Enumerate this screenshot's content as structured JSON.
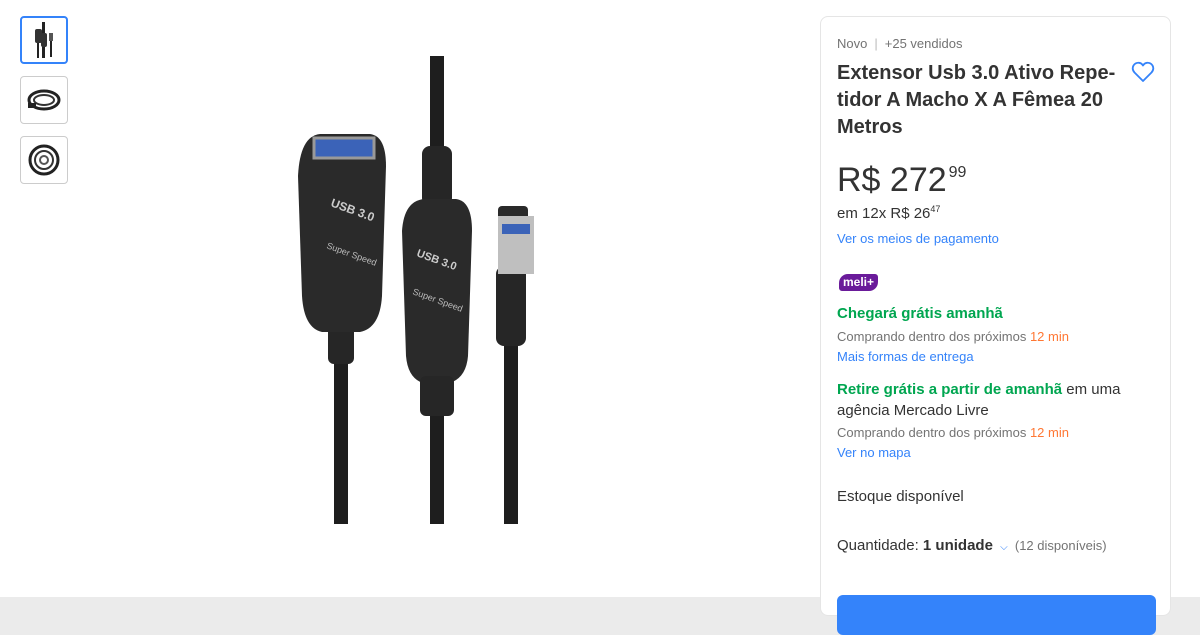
{
  "product": {
    "condition": "Novo",
    "sold": "+25 vendidos",
    "title": "Extensor Usb 3.0 Ativo Repe-tidor A Macho X A Fêmea 20 Metros",
    "price_currency": "R$",
    "price_whole": "272",
    "price_cents": "99",
    "installments_prefix": "em 12x R$",
    "installments_whole": "26",
    "installments_cents": "47",
    "payment_link": "Ver os meios de pagamento"
  },
  "shipping": {
    "badge": "meli+",
    "arrival": "Chegará grátis amanhã",
    "buy_within_prefix": "Comprando dentro dos próximos",
    "buy_within_time": "12 min",
    "more_options": "Mais formas de entrega",
    "pickup_highlight": "Retire grátis a partir de amanhã",
    "pickup_rest": " em uma agência Mercado Livre",
    "buy_within_prefix_2": "Comprando dentro dos próximos",
    "buy_within_time_2": "12 min",
    "map_link": "Ver no mapa"
  },
  "stock": {
    "label": "Estoque disponível",
    "quantity_label": "Quantidade:",
    "quantity_value": "1 unidade",
    "available": "(12 disponíveis)"
  },
  "colors": {
    "accent": "#3483fa",
    "green": "#00a650",
    "orange": "#ff7733",
    "meli_purple": "#6a1b9a"
  },
  "icons": {
    "favorite": "heart-outline-icon",
    "quantity_dropdown": "chevron-down-icon"
  }
}
